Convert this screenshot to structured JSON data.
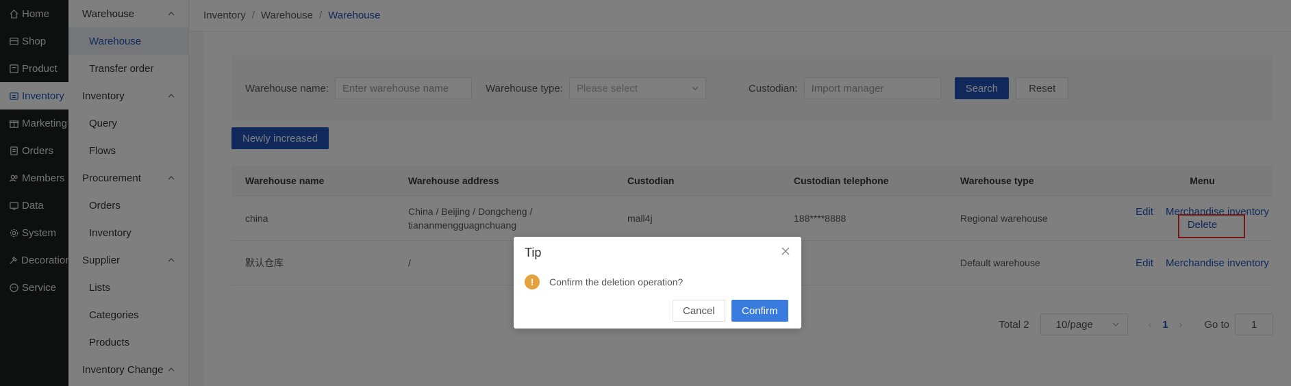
{
  "primary_nav": [
    {
      "label": "Home",
      "icon": "home-icon",
      "active": false
    },
    {
      "label": "Shop",
      "icon": "shop-icon",
      "active": false
    },
    {
      "label": "Product",
      "icon": "product-icon",
      "active": false
    },
    {
      "label": "Inventory",
      "icon": "inventory-icon",
      "active": true
    },
    {
      "label": "Marketing",
      "icon": "gift-icon",
      "active": false
    },
    {
      "label": "Orders",
      "icon": "orders-icon",
      "active": false
    },
    {
      "label": "Members",
      "icon": "members-icon",
      "active": false
    },
    {
      "label": "Data",
      "icon": "data-icon",
      "active": false
    },
    {
      "label": "System",
      "icon": "gear-icon",
      "active": false
    },
    {
      "label": "Decoration",
      "icon": "decoration-icon",
      "active": false
    },
    {
      "label": "Service",
      "icon": "chat-icon",
      "active": false
    }
  ],
  "secondary_nav": {
    "groups": [
      {
        "label": "Warehouse",
        "items": [
          "Warehouse",
          "Transfer order"
        ]
      },
      {
        "label": "Inventory",
        "items": [
          "Query",
          "Flows"
        ]
      },
      {
        "label": "Procurement",
        "items": [
          "Orders",
          "Inventory"
        ]
      },
      {
        "label": "Supplier",
        "items": [
          "Lists",
          "Categories",
          "Products"
        ]
      },
      {
        "label": "Inventory Change",
        "items": []
      }
    ],
    "active_item": "Warehouse"
  },
  "breadcrumb": {
    "items": [
      "Inventory",
      "Warehouse",
      "Warehouse"
    ],
    "separator": "/"
  },
  "search": {
    "name_label": "Warehouse name:",
    "name_placeholder": "Enter warehouse name",
    "type_label": "Warehouse type:",
    "type_placeholder": "Please select",
    "custodian_label": "Custodian:",
    "custodian_placeholder": "Import manager",
    "search_button": "Search",
    "reset_button": "Reset"
  },
  "add_button": "Newly increased",
  "table": {
    "headers": [
      "Warehouse name",
      "Warehouse address",
      "Custodian",
      "Custodian telephone",
      "Warehouse type",
      "Menu"
    ],
    "rows": [
      {
        "name": "china",
        "address": "China / Beijing / Dongcheng / tiananmengguagnchuang",
        "custodian": "mall4j",
        "telephone": "188****8888",
        "type": "Regional warehouse",
        "actions": [
          "Edit",
          "Merchandise inventory",
          "Delete"
        ]
      },
      {
        "name": "默认仓库",
        "address": "/",
        "custodian": "",
        "telephone": "",
        "type": "Default warehouse",
        "actions": [
          "Edit",
          "Merchandise inventory"
        ]
      }
    ]
  },
  "pagination": {
    "total": "Total 2",
    "page_size": "10/page",
    "current_page": "1",
    "goto_label": "Go to",
    "goto_value": "1"
  },
  "dialog": {
    "title": "Tip",
    "message": "Confirm the deletion operation?",
    "cancel": "Cancel",
    "confirm": "Confirm"
  },
  "colors": {
    "primary": "#1e52b8",
    "warning": "#e6a23c",
    "highlight": "#e03030",
    "sidebar_bg": "#1d1e1f"
  }
}
